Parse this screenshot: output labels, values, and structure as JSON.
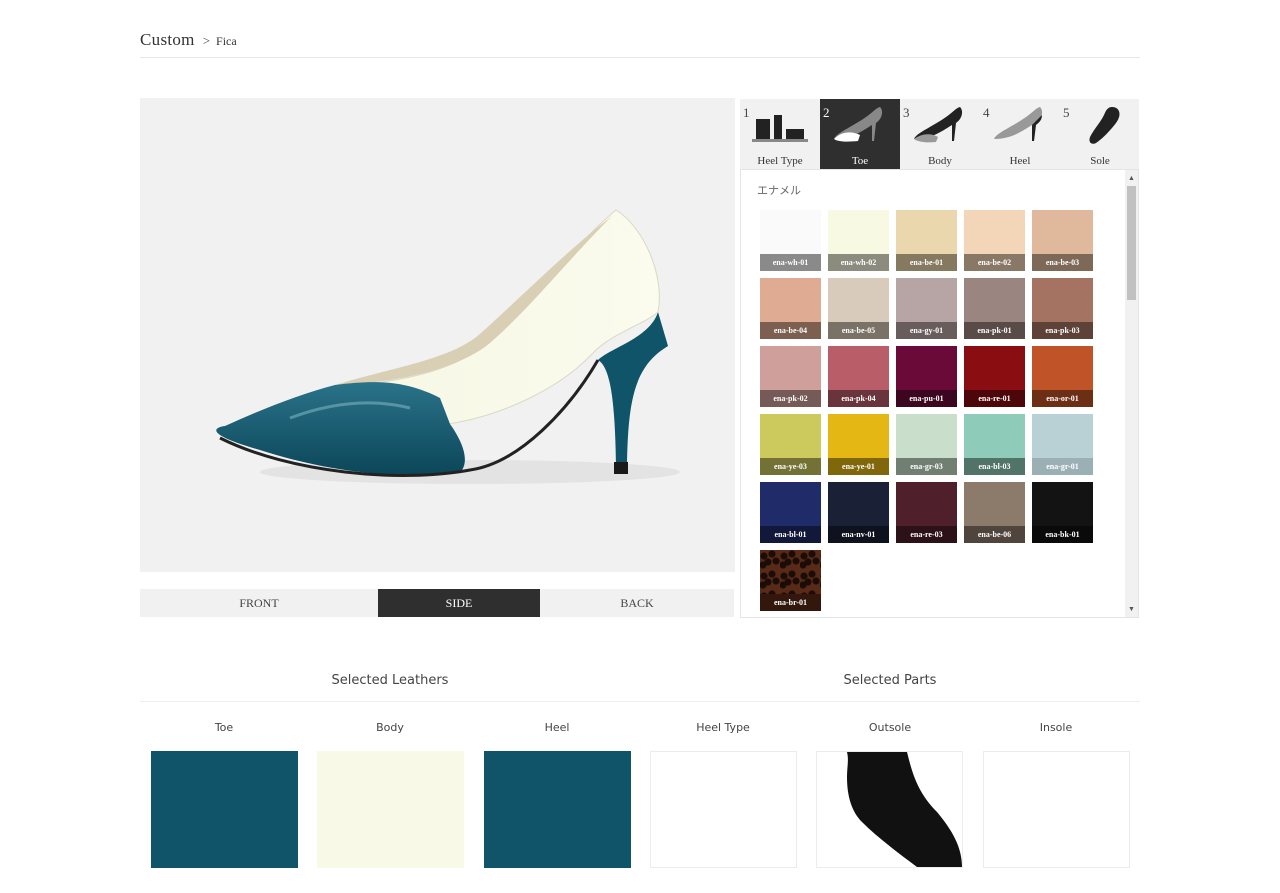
{
  "header": {
    "title": "Custom",
    "separator": ">",
    "model": "Fica"
  },
  "views": {
    "items": [
      "FRONT",
      "SIDE",
      "BACK"
    ],
    "active": "SIDE"
  },
  "tabs": [
    {
      "num": "1",
      "label": "Heel Type",
      "icon": "heel-type-icon"
    },
    {
      "num": "2",
      "label": "Toe",
      "icon": "toe-icon",
      "active": true
    },
    {
      "num": "3",
      "label": "Body",
      "icon": "body-icon"
    },
    {
      "num": "4",
      "label": "Heel",
      "icon": "heel-icon"
    },
    {
      "num": "5",
      "label": "Sole",
      "icon": "sole-icon"
    }
  ],
  "palette": {
    "group_label": "エナメル",
    "swatches": [
      {
        "code": "ena-wh-01",
        "color": "#fafafa",
        "bar": "#8a8a8a"
      },
      {
        "code": "ena-wh-02",
        "color": "#f8f9e2",
        "bar": "#8c8c7e"
      },
      {
        "code": "ena-be-01",
        "color": "#ead7ae",
        "bar": "#857a60"
      },
      {
        "code": "ena-be-02",
        "color": "#f2d6b7",
        "bar": "#8a7866"
      },
      {
        "code": "ena-be-03",
        "color": "#e0b99c",
        "bar": "#7e6858"
      },
      {
        "code": "ena-be-04",
        "color": "#dfab92",
        "bar": "#7c5f51"
      },
      {
        "code": "ena-be-05",
        "color": "#d8cbbb",
        "bar": "#7a7267"
      },
      {
        "code": "ena-gy-01",
        "color": "#b7a4a4",
        "bar": "#685c5c"
      },
      {
        "code": "ena-pk-01",
        "color": "#9b8581",
        "bar": "#584b48"
      },
      {
        "code": "ena-pk-03",
        "color": "#a57361",
        "bar": "#5e4137"
      },
      {
        "code": "ena-pk-02",
        "color": "#cf9f9b",
        "bar": "#765a57"
      },
      {
        "code": "ena-pk-04",
        "color": "#b95d68",
        "bar": "#69343b"
      },
      {
        "code": "ena-pu-01",
        "color": "#6a0a38",
        "bar": "#3c0620"
      },
      {
        "code": "ena-re-01",
        "color": "#890d11",
        "bar": "#4d070a"
      },
      {
        "code": "ena-or-01",
        "color": "#c05428",
        "bar": "#6c2f16"
      },
      {
        "code": "ena-ye-03",
        "color": "#ccc95d",
        "bar": "#737135"
      },
      {
        "code": "ena-ye-01",
        "color": "#e4b715",
        "bar": "#81670b"
      },
      {
        "code": "ena-gr-03",
        "color": "#c9dfcb",
        "bar": "#717e72"
      },
      {
        "code": "ena-bl-03",
        "color": "#8fcbb9",
        "bar": "#517368"
      },
      {
        "code": "ena-gr-01",
        "color": "#b9d0d5",
        "bar": "#9bb0b5"
      },
      {
        "code": "ena-bl-01",
        "color": "#1f2c69",
        "bar": "#11183a"
      },
      {
        "code": "ena-nv-01",
        "color": "#1a2036",
        "bar": "#0e111e"
      },
      {
        "code": "ena-re-03",
        "color": "#4f1f2b",
        "bar": "#2c1118"
      },
      {
        "code": "ena-be-06",
        "color": "#8c7b6b",
        "bar": "#4f453c"
      },
      {
        "code": "ena-bk-01",
        "color": "#131313",
        "bar": "#0a0a0a"
      },
      {
        "code": "ena-br-01",
        "color": "#5a2a18",
        "bar": "#33170d",
        "pattern": "leopard"
      }
    ]
  },
  "summary": {
    "leathers_title": "Selected Leathers",
    "parts_title": "Selected Parts",
    "columns": [
      {
        "label": "Toe",
        "color": "#0f5468"
      },
      {
        "label": "Body",
        "color": "#f8f9e6"
      },
      {
        "label": "Heel",
        "color": "#0f5468"
      },
      {
        "label": "Heel Type",
        "color": ""
      },
      {
        "label": "Outsole",
        "color": "",
        "shape": "sole"
      },
      {
        "label": "Insole",
        "color": ""
      }
    ]
  },
  "colors": {
    "accent_dark": "#2f2f2f",
    "panel_bg": "#f1f1f1"
  }
}
